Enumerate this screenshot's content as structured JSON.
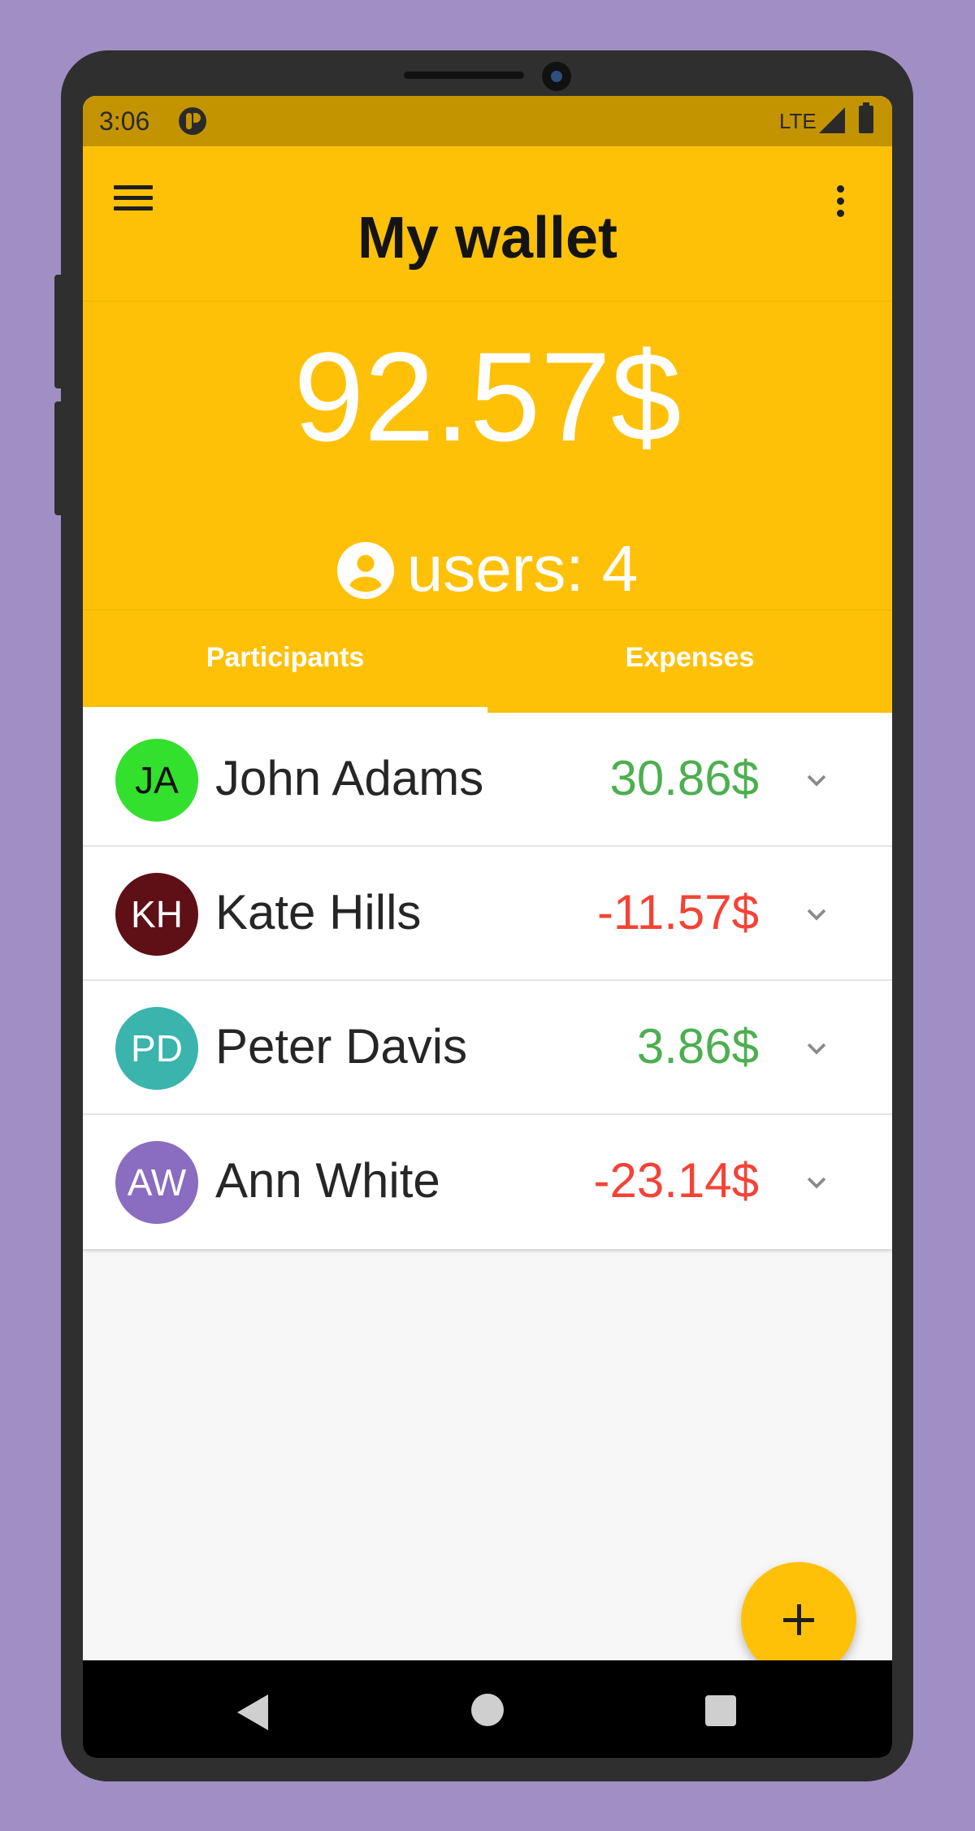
{
  "status_bar": {
    "time": "3:06",
    "network": "LTE",
    "icons": [
      "app-notification-icon",
      "signal-icon",
      "battery-icon"
    ]
  },
  "header": {
    "title": "My wallet",
    "balance": "92.57$",
    "users_label": "users: 4",
    "menu_icon": "hamburger-menu-icon",
    "more_icon": "more-vert-icon"
  },
  "tabs": [
    {
      "label": "Participants",
      "selected": true
    },
    {
      "label": "Expenses",
      "selected": false
    }
  ],
  "participants": [
    {
      "initials": "JA",
      "name": "John Adams",
      "amount": "30.86$",
      "avatar_color": "#33e02d",
      "initials_color": "#111111",
      "amount_sign": "positive"
    },
    {
      "initials": "KH",
      "name": "Kate Hills",
      "amount": "-11.57$",
      "avatar_color": "#5e1016",
      "initials_color": "#ffffff",
      "amount_sign": "negative"
    },
    {
      "initials": "PD",
      "name": "Peter Davis",
      "amount": "3.86$",
      "avatar_color": "#3ab4ac",
      "initials_color": "#ffffff",
      "amount_sign": "positive"
    },
    {
      "initials": "AW",
      "name": "Ann White",
      "amount": "-23.14$",
      "avatar_color": "#8a6cc0",
      "initials_color": "#ffffff",
      "amount_sign": "negative"
    }
  ],
  "fab": {
    "icon": "plus-icon"
  },
  "nav_bar": {
    "icons": [
      "back-icon",
      "home-icon",
      "recents-icon"
    ]
  },
  "colors": {
    "primary": "#ffc107",
    "status_bar": "#c49400",
    "positive": "#4caf50",
    "negative": "#f44336",
    "background": "#a08fc4"
  }
}
